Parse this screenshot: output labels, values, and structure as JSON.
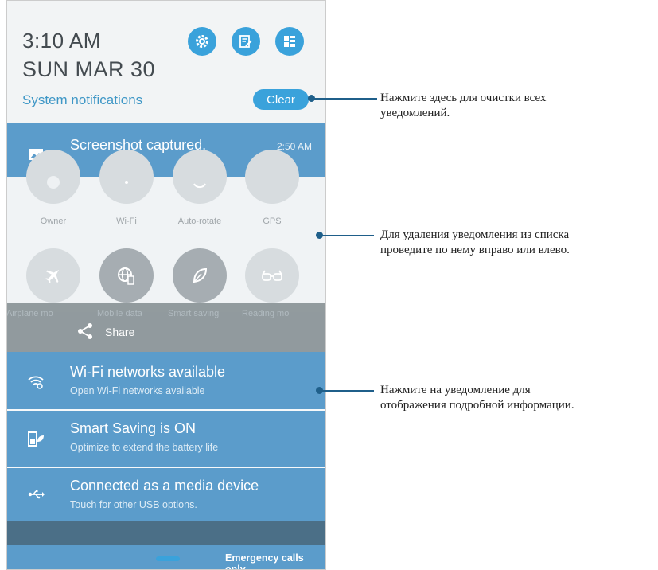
{
  "status": {
    "time": "3:10 AM",
    "date": "SUN MAR 30"
  },
  "header": {
    "system_notifications": "System notifications",
    "clear_label": "Clear",
    "buttons": [
      {
        "icon": "settings-icon"
      },
      {
        "icon": "edit-icon"
      },
      {
        "icon": "quick-settings-icon"
      }
    ]
  },
  "screenshot_notif": {
    "title": "Screenshot captured.",
    "time": "2:50 AM",
    "icon": "image-icon"
  },
  "quick_settings": {
    "row1_labels": [
      "Owner",
      "Wi-Fi",
      "Auto-rotate",
      "GPS"
    ],
    "row2_icons": [
      "airplane-icon",
      "mobile-data-icon",
      "leaf-icon",
      "glasses-icon"
    ],
    "row2_labels_partial": [
      "Airplane mo",
      "Mobile data",
      "Smart saving",
      "Reading mo"
    ]
  },
  "share": {
    "label": "Share"
  },
  "notifications": [
    {
      "title": "Wi-Fi networks available",
      "subtitle": "Open Wi-Fi networks available",
      "icon": "wifi-icon"
    },
    {
      "title": "Smart Saving is ON",
      "subtitle": "Optimize to extend the battery life",
      "icon": "battery-leaf-icon"
    },
    {
      "title": "Connected as a media device",
      "subtitle": "Touch for other USB options.",
      "icon": "usb-icon"
    }
  ],
  "footer": {
    "emergency": "Emergency calls only"
  },
  "callouts": [
    {
      "line1": "Нажмите здесь для очистки всех",
      "line2": "уведомлений."
    },
    {
      "line1": "Для удаления уведомления из списка",
      "line2": "проведите по нему вправо или влево."
    },
    {
      "line1": "Нажмите на уведомление для",
      "line2": "отображения подробной информации."
    }
  ],
  "colors": {
    "accent": "#3aa2db",
    "notification": "#5b9ccb",
    "callout_line": "#1f5f8a"
  }
}
